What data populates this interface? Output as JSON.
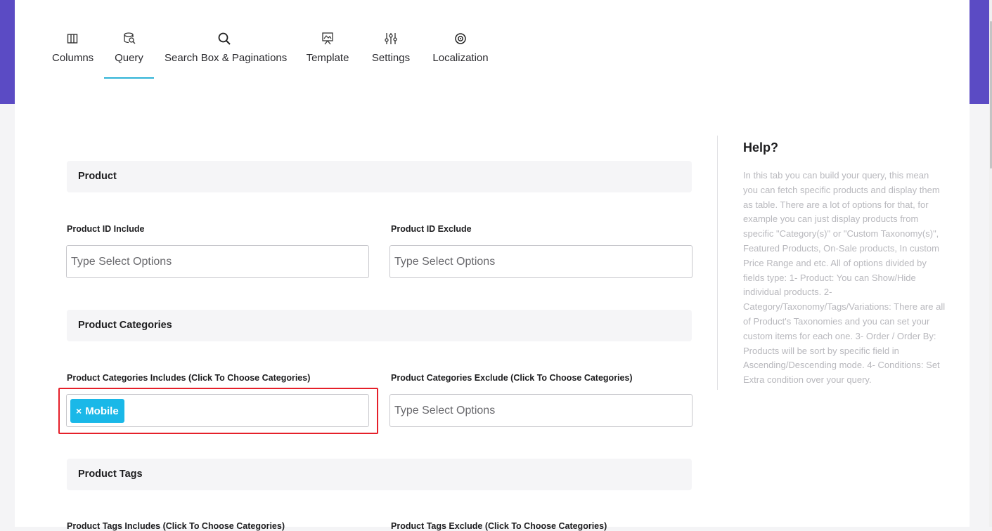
{
  "tabs": [
    {
      "label": "Columns",
      "icon": "columns-icon"
    },
    {
      "label": "Query",
      "icon": "query-icon",
      "active": true
    },
    {
      "label": "Search Box & Paginations",
      "icon": "search-icon"
    },
    {
      "label": "Template",
      "icon": "template-icon"
    },
    {
      "label": "Settings",
      "icon": "sliders-icon"
    },
    {
      "label": "Localization",
      "icon": "target-icon"
    }
  ],
  "sections": {
    "product": {
      "title": "Product",
      "include_label": "Product ID Include",
      "include_placeholder": "Type Select Options",
      "exclude_label": "Product ID Exclude",
      "exclude_placeholder": "Type Select Options"
    },
    "categories": {
      "title": "Product Categories",
      "include_label": "Product Categories Includes (Click To Choose Categories)",
      "include_chip_remove": "×",
      "include_chip": "Mobile",
      "exclude_label": "Product Categories Exclude (Click To Choose Categories)",
      "exclude_placeholder": "Type Select Options"
    },
    "tags": {
      "title": "Product Tags",
      "include_label": "Product Tags Includes (Click To Choose Categories)",
      "exclude_label": "Product Tags Exclude (Click To Choose Categories)"
    }
  },
  "help": {
    "title": "Help?",
    "text": "In this tab you can build your query, this mean you can fetch specific products and display them as table. There are a lot of options for that, for example you can just display products from specific \"Category(s)\" or \"Custom Taxonomy(s)\", Featured Products, On-Sale products, In custom Price Range and etc. All of options divided by fields type: 1- Product: You can Show/Hide individual products. 2- Category/Taxonomy/Tags/Variations: There are all of Product's Taxonomies and you can set your custom items for each one. 3- Order / Order By: Products will be sort by specific field in Ascending/Descending mode. 4- Conditions: Set Extra condition over your query."
  },
  "colors": {
    "accent_purple": "#5b4bc4",
    "tab_underline": "#2fb3d6",
    "chip_bg": "#1ab8e8",
    "highlight_red": "#e5202a"
  }
}
